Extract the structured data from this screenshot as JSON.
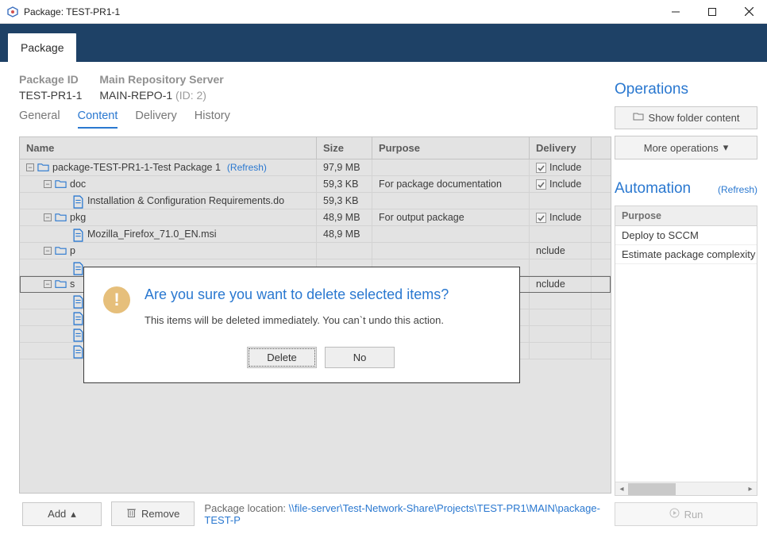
{
  "window": {
    "title": "Package: TEST-PR1-1"
  },
  "ribbon": {
    "tab": "Package"
  },
  "meta": {
    "package_id_label": "Package ID",
    "package_id": "TEST-PR1-1",
    "repo_label": "Main Repository Server",
    "repo_value": "MAIN-REPO-1",
    "repo_hint": "(ID: 2)"
  },
  "page_tabs": [
    "General",
    "Content",
    "Delivery",
    "History"
  ],
  "page_tab_active": 1,
  "columns": {
    "name": "Name",
    "size": "Size",
    "purpose": "Purpose",
    "delivery": "Delivery"
  },
  "refresh_text": "(Refresh)",
  "include_text": "Include",
  "rows": [
    {
      "indent": 0,
      "type": "folder",
      "expand": "-",
      "name": "package-TEST-PR1-1-Test Package 1",
      "refresh": true,
      "size": "97,9 MB",
      "purpose": "",
      "delivery": true
    },
    {
      "indent": 1,
      "type": "folder",
      "expand": "-",
      "name": "doc",
      "size": "59,3 KB",
      "purpose": "For package documentation",
      "delivery": true
    },
    {
      "indent": 2,
      "type": "file",
      "name": "Installation & Configuration Requirements.do",
      "size": "59,3 KB",
      "purpose": "",
      "delivery": null
    },
    {
      "indent": 1,
      "type": "folder",
      "expand": "-",
      "name": "pkg",
      "size": "48,9 MB",
      "purpose": "For output package",
      "delivery": true
    },
    {
      "indent": 2,
      "type": "file",
      "name": "Mozilla_Firefox_71.0_EN.msi",
      "size": "48,9 MB",
      "purpose": "",
      "delivery": null
    },
    {
      "indent": 1,
      "type": "folder",
      "expand": "-",
      "name": "p",
      "cut": true,
      "size": "",
      "purpose": "",
      "delivery_cut": "nclude"
    },
    {
      "indent": 2,
      "type": "file",
      "name": "",
      "cut": true,
      "size": "",
      "purpose": "",
      "delivery": null
    },
    {
      "indent": 1,
      "type": "folder",
      "expand": "-",
      "name": "s",
      "cut": true,
      "selected": true,
      "size": "",
      "purpose": "",
      "delivery_cut": "nclude"
    },
    {
      "indent": 2,
      "type": "file",
      "name": "",
      "cut": true,
      "size": "",
      "purpose": "",
      "delivery": null
    },
    {
      "indent": 2,
      "type": "file",
      "name": "",
      "cut": true,
      "size": "",
      "purpose": "",
      "delivery": null
    },
    {
      "indent": 2,
      "type": "file",
      "name": "",
      "cut": true,
      "size": "",
      "purpose": "",
      "delivery": null
    },
    {
      "indent": 2,
      "type": "file",
      "name": "",
      "cut": true,
      "size": "",
      "purpose": "",
      "delivery": null
    }
  ],
  "bottom": {
    "add": "Add",
    "remove": "Remove",
    "loc_label": "Package location:",
    "loc_path": "\\\\file-server\\Test-Network-Share\\Projects\\TEST-PR1\\MAIN\\package-TEST-P"
  },
  "ops": {
    "title": "Operations",
    "show_folder": "Show folder content",
    "more": "More operations"
  },
  "automation": {
    "title": "Automation",
    "refresh": "(Refresh)",
    "header": "Purpose",
    "items": [
      "Deploy to SCCM",
      "Estimate package complexity"
    ],
    "run": "Run"
  },
  "dialog": {
    "title": "Are you sure you want to delete selected items?",
    "message": "This items will be deleted immediately. You can`t undo this action.",
    "delete": "Delete",
    "no": "No"
  }
}
